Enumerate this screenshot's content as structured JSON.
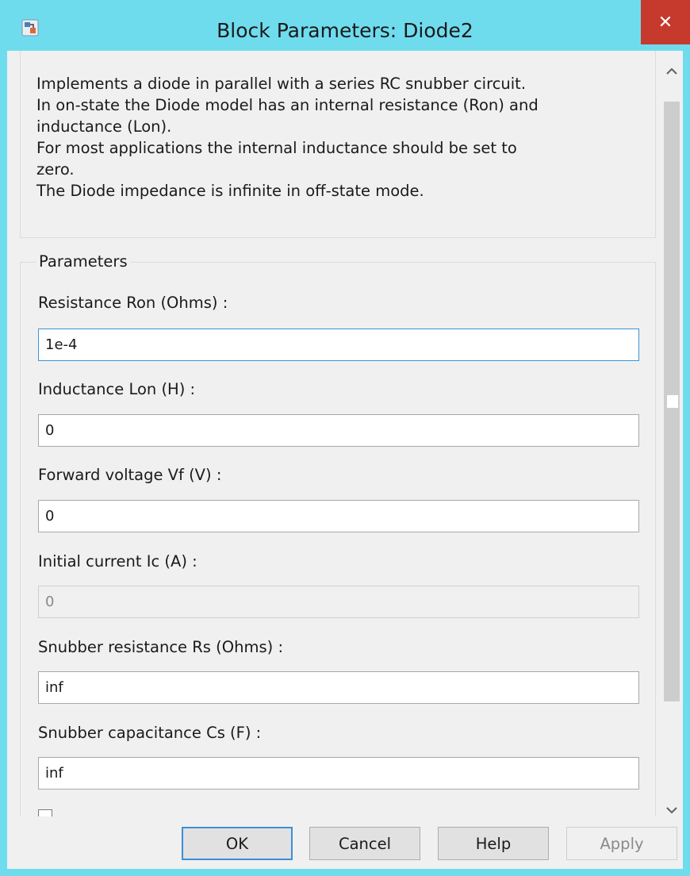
{
  "window": {
    "title": "Block Parameters: Diode2",
    "close_glyph": "✕"
  },
  "description": {
    "lines": [
      "Implements a diode in parallel with a series RC snubber circuit.",
      "In on-state the Diode model has an internal resistance (Ron) and",
      "inductance (Lon).",
      "For most applications the internal inductance should be set to",
      "zero.",
      "The Diode impedance is infinite in off-state mode."
    ]
  },
  "parameters": {
    "legend": "Parameters",
    "fields": [
      {
        "label": "Resistance Ron (Ohms) :",
        "value": "1e-4",
        "enabled": true,
        "focused": true
      },
      {
        "label": "Inductance Lon (H) :",
        "value": "0",
        "enabled": true
      },
      {
        "label": "Forward voltage Vf (V) :",
        "value": "0",
        "enabled": true
      },
      {
        "label": "Initial current Ic (A) :",
        "value": "0",
        "enabled": false
      },
      {
        "label": "Snubber resistance Rs (Ohms) :",
        "value": "inf",
        "enabled": true
      },
      {
        "label": "Snubber capacitance Cs (F) :",
        "value": "inf",
        "enabled": true
      }
    ]
  },
  "buttons": {
    "ok": "OK",
    "cancel": "Cancel",
    "help": "Help",
    "apply": "Apply"
  },
  "scrollbar": {
    "up_glyph": "^",
    "down_glyph": "v"
  },
  "colors": {
    "titlebar": "#6fdcee",
    "close": "#c6392d",
    "focus": "#3b96d8",
    "default_button": "#3c8fd8"
  }
}
